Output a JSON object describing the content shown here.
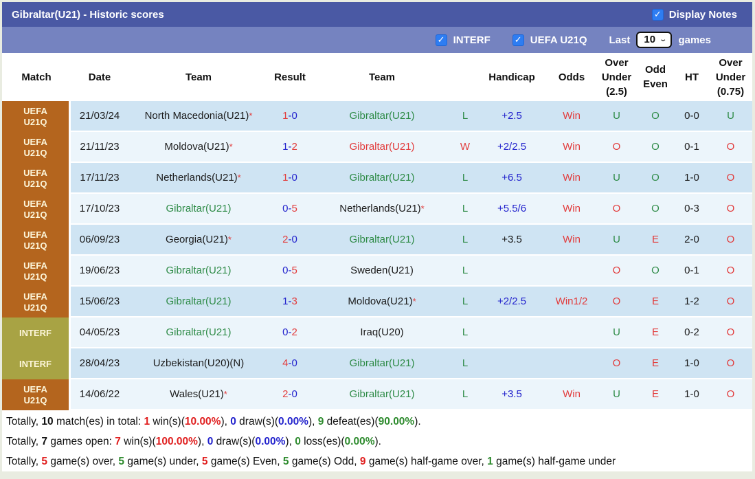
{
  "header": {
    "title": "Gibraltar(U21) - Historic scores",
    "display_notes_label": "Display Notes",
    "display_notes_checked": true
  },
  "filters": {
    "interf_label": "INTERF",
    "interf_checked": true,
    "uefa_label": "UEFA U21Q",
    "uefa_checked": true,
    "last_label": "Last",
    "games_count": "10",
    "games_label": "games"
  },
  "colors": {
    "title_bar": "#4a59a4",
    "filter_bar": "#7583c0",
    "checkbox_blue": "#2e7df2",
    "uefa_badge": "#b4651e",
    "interf_badge": "#a8a344",
    "row_dark": "#cfe4f3",
    "row_light": "#ecf5fb",
    "win_red": "#e23b3b",
    "loss_green": "#2e8b47",
    "handicap_blue": "#2323cd"
  },
  "table": {
    "columns": [
      "Match",
      "Date",
      "Team",
      "Result",
      "Team",
      "",
      "Handicap",
      "Odds",
      "Over Under (2.5)",
      "Odd Even",
      "HT",
      "Over Under (0.75)"
    ],
    "rows": [
      {
        "competition": "UEFA U21Q",
        "competition_type": "uefa",
        "date": "21/03/24",
        "home_team": {
          "name": "North Macedonia(U21)",
          "star": true,
          "color": "black"
        },
        "result": {
          "home": "1",
          "away": "0",
          "home_color": "red",
          "away_color": "blue"
        },
        "away_team": {
          "name": "Gibraltar(U21)",
          "star": false,
          "color": "green"
        },
        "wl": {
          "text": "L",
          "color": "green"
        },
        "handicap": {
          "text": "+2.5",
          "color": "blue"
        },
        "odds": {
          "text": "Win",
          "color": "red"
        },
        "over_under_25": {
          "text": "U",
          "color": "green"
        },
        "odd_even": {
          "text": "O",
          "color": "green"
        },
        "ht": "0-0",
        "over_under_075": {
          "text": "U",
          "color": "green"
        },
        "row_shade": "dark"
      },
      {
        "competition": "UEFA U21Q",
        "competition_type": "uefa",
        "date": "21/11/23",
        "home_team": {
          "name": "Moldova(U21)",
          "star": true,
          "color": "black"
        },
        "result": {
          "home": "1",
          "away": "2",
          "home_color": "blue",
          "away_color": "red"
        },
        "away_team": {
          "name": "Gibraltar(U21)",
          "star": false,
          "color": "red"
        },
        "wl": {
          "text": "W",
          "color": "red"
        },
        "handicap": {
          "text": "+2/2.5",
          "color": "blue"
        },
        "odds": {
          "text": "Win",
          "color": "red"
        },
        "over_under_25": {
          "text": "O",
          "color": "red"
        },
        "odd_even": {
          "text": "O",
          "color": "green"
        },
        "ht": "0-1",
        "over_under_075": {
          "text": "O",
          "color": "red"
        },
        "row_shade": "light"
      },
      {
        "competition": "UEFA U21Q",
        "competition_type": "uefa",
        "date": "17/11/23",
        "home_team": {
          "name": "Netherlands(U21)",
          "star": true,
          "color": "black"
        },
        "result": {
          "home": "1",
          "away": "0",
          "home_color": "red",
          "away_color": "blue"
        },
        "away_team": {
          "name": "Gibraltar(U21)",
          "star": false,
          "color": "green"
        },
        "wl": {
          "text": "L",
          "color": "green"
        },
        "handicap": {
          "text": "+6.5",
          "color": "blue"
        },
        "odds": {
          "text": "Win",
          "color": "red"
        },
        "over_under_25": {
          "text": "U",
          "color": "green"
        },
        "odd_even": {
          "text": "O",
          "color": "green"
        },
        "ht": "1-0",
        "over_under_075": {
          "text": "O",
          "color": "red"
        },
        "row_shade": "dark"
      },
      {
        "competition": "UEFA U21Q",
        "competition_type": "uefa",
        "date": "17/10/23",
        "home_team": {
          "name": "Gibraltar(U21)",
          "star": false,
          "color": "green"
        },
        "result": {
          "home": "0",
          "away": "5",
          "home_color": "blue",
          "away_color": "red"
        },
        "away_team": {
          "name": "Netherlands(U21)",
          "star": true,
          "color": "black"
        },
        "wl": {
          "text": "L",
          "color": "green"
        },
        "handicap": {
          "text": "+5.5/6",
          "color": "blue"
        },
        "odds": {
          "text": "Win",
          "color": "red"
        },
        "over_under_25": {
          "text": "O",
          "color": "red"
        },
        "odd_even": {
          "text": "O",
          "color": "green"
        },
        "ht": "0-3",
        "over_under_075": {
          "text": "O",
          "color": "red"
        },
        "row_shade": "light"
      },
      {
        "competition": "UEFA U21Q",
        "competition_type": "uefa",
        "date": "06/09/23",
        "home_team": {
          "name": "Georgia(U21)",
          "star": true,
          "color": "black"
        },
        "result": {
          "home": "2",
          "away": "0",
          "home_color": "red",
          "away_color": "blue"
        },
        "away_team": {
          "name": "Gibraltar(U21)",
          "star": false,
          "color": "green"
        },
        "wl": {
          "text": "L",
          "color": "green"
        },
        "handicap": {
          "text": "+3.5",
          "color": "black"
        },
        "odds": {
          "text": "Win",
          "color": "red"
        },
        "over_under_25": {
          "text": "U",
          "color": "green"
        },
        "odd_even": {
          "text": "E",
          "color": "red"
        },
        "ht": "2-0",
        "over_under_075": {
          "text": "O",
          "color": "red"
        },
        "row_shade": "dark"
      },
      {
        "competition": "UEFA U21Q",
        "competition_type": "uefa",
        "date": "19/06/23",
        "home_team": {
          "name": "Gibraltar(U21)",
          "star": false,
          "color": "green"
        },
        "result": {
          "home": "0",
          "away": "5",
          "home_color": "blue",
          "away_color": "red"
        },
        "away_team": {
          "name": "Sweden(U21)",
          "star": false,
          "color": "black"
        },
        "wl": {
          "text": "L",
          "color": "green"
        },
        "handicap": {
          "text": "",
          "color": "blue"
        },
        "odds": {
          "text": "",
          "color": "red"
        },
        "over_under_25": {
          "text": "O",
          "color": "red"
        },
        "odd_even": {
          "text": "O",
          "color": "green"
        },
        "ht": "0-1",
        "over_under_075": {
          "text": "O",
          "color": "red"
        },
        "row_shade": "light"
      },
      {
        "competition": "UEFA U21Q",
        "competition_type": "uefa",
        "date": "15/06/23",
        "home_team": {
          "name": "Gibraltar(U21)",
          "star": false,
          "color": "green"
        },
        "result": {
          "home": "1",
          "away": "3",
          "home_color": "blue",
          "away_color": "red"
        },
        "away_team": {
          "name": "Moldova(U21)",
          "star": true,
          "color": "black"
        },
        "wl": {
          "text": "L",
          "color": "green"
        },
        "handicap": {
          "text": "+2/2.5",
          "color": "blue"
        },
        "odds": {
          "text": "Win1/2",
          "color": "red"
        },
        "over_under_25": {
          "text": "O",
          "color": "red"
        },
        "odd_even": {
          "text": "E",
          "color": "red"
        },
        "ht": "1-2",
        "over_under_075": {
          "text": "O",
          "color": "red"
        },
        "row_shade": "dark"
      },
      {
        "competition": "INTERF",
        "competition_type": "interf",
        "date": "04/05/23",
        "home_team": {
          "name": "Gibraltar(U21)",
          "star": false,
          "color": "green"
        },
        "result": {
          "home": "0",
          "away": "2",
          "home_color": "blue",
          "away_color": "red"
        },
        "away_team": {
          "name": "Iraq(U20)",
          "star": false,
          "color": "black"
        },
        "wl": {
          "text": "L",
          "color": "green"
        },
        "handicap": {
          "text": "",
          "color": "blue"
        },
        "odds": {
          "text": "",
          "color": "red"
        },
        "over_under_25": {
          "text": "U",
          "color": "green"
        },
        "odd_even": {
          "text": "E",
          "color": "red"
        },
        "ht": "0-2",
        "over_under_075": {
          "text": "O",
          "color": "red"
        },
        "row_shade": "light"
      },
      {
        "competition": "INTERF",
        "competition_type": "interf",
        "date": "28/04/23",
        "home_team": {
          "name": "Uzbekistan(U20)(N)",
          "star": false,
          "color": "black"
        },
        "result": {
          "home": "4",
          "away": "0",
          "home_color": "red",
          "away_color": "blue"
        },
        "away_team": {
          "name": "Gibraltar(U21)",
          "star": false,
          "color": "green"
        },
        "wl": {
          "text": "L",
          "color": "green"
        },
        "handicap": {
          "text": "",
          "color": "blue"
        },
        "odds": {
          "text": "",
          "color": "red"
        },
        "over_under_25": {
          "text": "O",
          "color": "red"
        },
        "odd_even": {
          "text": "E",
          "color": "red"
        },
        "ht": "1-0",
        "over_under_075": {
          "text": "O",
          "color": "red"
        },
        "row_shade": "dark"
      },
      {
        "competition": "UEFA U21Q",
        "competition_type": "uefa",
        "date": "14/06/22",
        "home_team": {
          "name": "Wales(U21)",
          "star": true,
          "color": "black"
        },
        "result": {
          "home": "2",
          "away": "0",
          "home_color": "red",
          "away_color": "blue"
        },
        "away_team": {
          "name": "Gibraltar(U21)",
          "star": false,
          "color": "green"
        },
        "wl": {
          "text": "L",
          "color": "green"
        },
        "handicap": {
          "text": "+3.5",
          "color": "blue"
        },
        "odds": {
          "text": "Win",
          "color": "red"
        },
        "over_under_25": {
          "text": "U",
          "color": "green"
        },
        "odd_even": {
          "text": "E",
          "color": "red"
        },
        "ht": "1-0",
        "over_under_075": {
          "text": "O",
          "color": "red"
        },
        "row_shade": "light"
      }
    ]
  },
  "footer": {
    "lines": [
      {
        "segments": [
          {
            "t": "Totally, "
          },
          {
            "t": "10",
            "s": "b"
          },
          {
            "t": " match(es) in total: "
          },
          {
            "t": "1",
            "s": "red"
          },
          {
            "t": " win(s)("
          },
          {
            "t": "10.00%",
            "s": "red"
          },
          {
            "t": "), "
          },
          {
            "t": "0",
            "s": "blue"
          },
          {
            "t": " draw(s)("
          },
          {
            "t": "0.00%",
            "s": "blue"
          },
          {
            "t": "), "
          },
          {
            "t": "9",
            "s": "green"
          },
          {
            "t": " defeat(es)("
          },
          {
            "t": "90.00%",
            "s": "green"
          },
          {
            "t": ")."
          }
        ]
      },
      {
        "segments": [
          {
            "t": "Totally, "
          },
          {
            "t": "7",
            "s": "b"
          },
          {
            "t": " games open: "
          },
          {
            "t": "7",
            "s": "red"
          },
          {
            "t": " win(s)("
          },
          {
            "t": "100.00%",
            "s": "red"
          },
          {
            "t": "), "
          },
          {
            "t": "0",
            "s": "blue"
          },
          {
            "t": " draw(s)("
          },
          {
            "t": "0.00%",
            "s": "blue"
          },
          {
            "t": "), "
          },
          {
            "t": "0",
            "s": "green"
          },
          {
            "t": " loss(es)("
          },
          {
            "t": "0.00%",
            "s": "green"
          },
          {
            "t": ")."
          }
        ]
      },
      {
        "segments": [
          {
            "t": "Totally, "
          },
          {
            "t": "5",
            "s": "red"
          },
          {
            "t": " game(s) over, "
          },
          {
            "t": "5",
            "s": "green"
          },
          {
            "t": " game(s) under, "
          },
          {
            "t": "5",
            "s": "red"
          },
          {
            "t": " game(s) Even, "
          },
          {
            "t": "5",
            "s": "green"
          },
          {
            "t": " game(s) Odd, "
          },
          {
            "t": "9",
            "s": "red"
          },
          {
            "t": " game(s) half-game over, "
          },
          {
            "t": "1",
            "s": "green"
          },
          {
            "t": " game(s) half-game under"
          }
        ]
      }
    ]
  }
}
